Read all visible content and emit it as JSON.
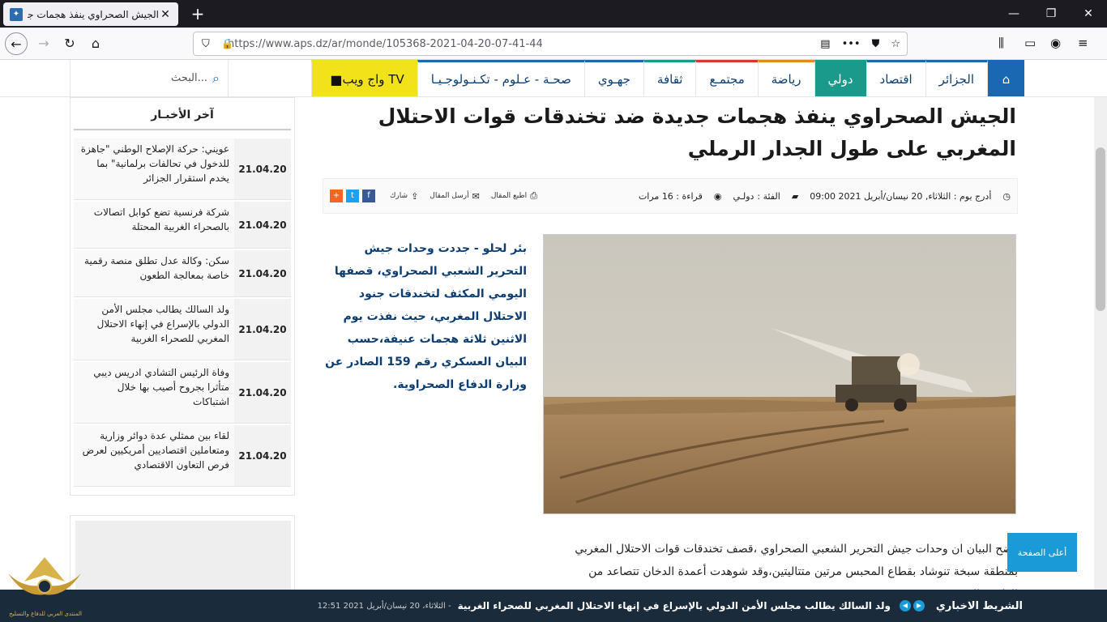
{
  "browser": {
    "tab_title": "الجيش الصحراوي ينفذ هجمات جديدة",
    "url": "https://www.aps.dz/ar/monde/105368-2021-04-20-07-41-44"
  },
  "menu": {
    "items": [
      "الجزائر",
      "اقتصاد",
      "دولي",
      "رياضة",
      "مجتمـع",
      "ثقافة",
      "جهـوي",
      "صحـة - عـلوم - تكـنـولوجـيـا"
    ],
    "tv_label": "واج ويب TV",
    "search_placeholder": "البحث..."
  },
  "article": {
    "title": "الجيش الصحراوي ينفذ هجمات جديدة ضد تخندقات قوات الاحتلال المغربي على طول الجدار الرملي",
    "meta_date": "أدرج يوم : الثلاثاء, 20 نيسان/أبريل 2021 09:00",
    "meta_category_label": "الفئة :",
    "meta_category": "دولـي",
    "meta_reads": "قراءة : 16 مرات",
    "print_label": "اطبع المقال",
    "send_label": "أرسل المقال",
    "share_label": "شارك",
    "lead": "بئر لحلو - جددت وحدات جيش التحرير الشعبي الصحراوي، قصفها اليومي المكثف لتخندقات جنود الاحتلال المغربي، حيث نفذت يوم الاثنين ثلاثة هجمات عنيفة،حسب البيان العسكري رقم 159 الصادر عن وزارة الدفاع الصحراوية.",
    "body": "وضح البيان ان وحدات جيش التحرير الشعبي الصحراوي ،قصف تخندقات قوات الاحتلال المغربي بمنطقة سبخة تنوشاد بقطاع المحبس مرتين متتاليتين،وقد شوهدت أعمدة الدخان تتصاعد من القاعدة المستهدفة."
  },
  "sidebar": {
    "title": "آخر الأخبـار",
    "news": [
      {
        "date": "21.04.20",
        "text": "عويني: حركة الإصلاح الوطني \"جاهزة للدخول في تحالفات برلمانية\" بما يخدم استقرار الجزائر"
      },
      {
        "date": "21.04.20",
        "text": "شركة فرنسية تضع كوابل اتصالات بالصحراء الغربية المحتلة"
      },
      {
        "date": "21.04.20",
        "text": "سكن: وكالة عدل تطلق منصة رقمية خاصة بمعالجة الطعون"
      },
      {
        "date": "21.04.20",
        "text": "ولد السالك يطالب مجلس الأمن الدولي بالإسراع في إنهاء الاحتلال المغربي للصحراء الغربية"
      },
      {
        "date": "21.04.20",
        "text": "وفاة الرئيس التشادي ادريس ديبي متأثرا بجروح أصيب بها خلال اشتباكات"
      },
      {
        "date": "21.04.20",
        "text": "لقاء بين ممثلي عدة دوائر وزارية ومتعاملين اقتصاديين أمريكيين لعرض فرص التعاون الاقتصادي"
      }
    ]
  },
  "back_to_top": "أعلى الصفحة",
  "ticker": {
    "label": "الشريط الاخباري",
    "headline": "ولد السالك يطالب مجلس الأمن الدولي بالإسراع في إنهاء الاحتلال المغربي للصحراء الغربية",
    "date": "- الثلاثاء، 20 نيسان/أبريل 2021 12:51"
  },
  "logo_text": "المنتدى العربي للدفاع والتسليح",
  "colors": {
    "brand_blue": "#1a67b2",
    "active_teal": "#1a9a8a",
    "tv_yellow": "#f2e21a",
    "lead_blue": "#0c3d73"
  }
}
